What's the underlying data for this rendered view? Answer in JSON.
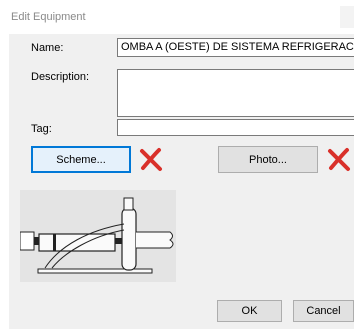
{
  "window": {
    "title": "Edit Equipment"
  },
  "form": {
    "name_label": "Name:",
    "name_value": "OMBA  A (OESTE) DE SISTEMA REFRIGERACION",
    "description_label": "Description:",
    "description_value": "",
    "tag_label": "Tag:",
    "tag_value": ""
  },
  "buttons": {
    "scheme": "Scheme...",
    "photo": "Photo...",
    "ok": "OK",
    "cancel": "Cancel"
  },
  "icons": {
    "delete_scheme": "red-x-delete-icon",
    "delete_photo": "red-x-delete-icon",
    "close": "close-icon"
  },
  "colors": {
    "delete_red": "#d9302a",
    "focus_blue": "#0078d7"
  }
}
